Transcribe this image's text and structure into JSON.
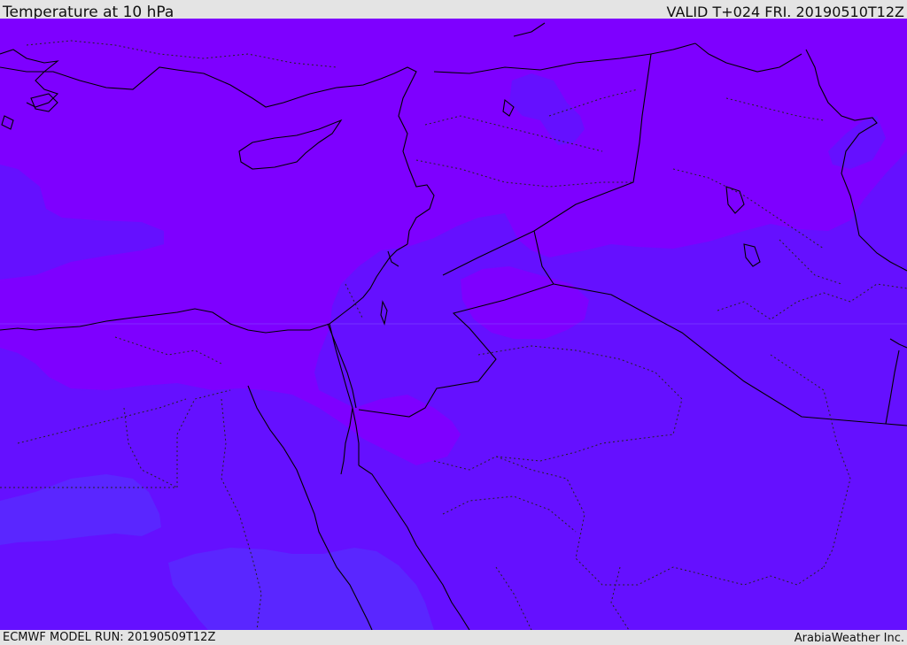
{
  "header": {
    "title": "Temperature at 10 hPa",
    "valid": "VALID T+024 FRI. 20190510T12Z"
  },
  "footer": {
    "model_run": "ECMWF MODEL RUN: 20190509T12Z",
    "credit": "ArabiaWeather Inc."
  },
  "colors": {
    "warm_band": "#7e00ff",
    "mid_band": "#6510ff",
    "cool_band": "#5a26ff",
    "coastline": "#000000",
    "border": "#000000",
    "internal_border": "#333333"
  }
}
